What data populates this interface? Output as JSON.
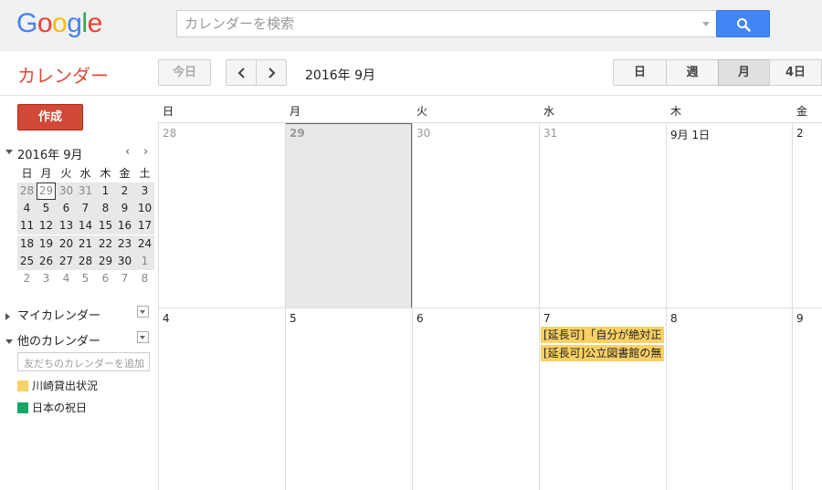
{
  "header": {
    "logo_letters": [
      {
        "ch": "G",
        "color": "#4285f4"
      },
      {
        "ch": "o",
        "color": "#ea4335"
      },
      {
        "ch": "o",
        "color": "#fbbc05"
      },
      {
        "ch": "g",
        "color": "#4285f4"
      },
      {
        "ch": "l",
        "color": "#34a853"
      },
      {
        "ch": "e",
        "color": "#ea4335"
      }
    ],
    "search_placeholder": "カレンダーを検索",
    "search_icon": "search-icon"
  },
  "toolbar": {
    "app_title": "カレンダー",
    "today_label": "今日",
    "prev_icon": "chevron-left-icon",
    "next_icon": "chevron-right-icon",
    "date_range": "2016年 9月",
    "views": {
      "day": "日",
      "week": "週",
      "month": "月",
      "four_day": "4日"
    },
    "active_view": "month"
  },
  "sidebar": {
    "create_label": "作成",
    "mini_calendar": {
      "title": "2016年 9月",
      "prev": "‹",
      "next": "›",
      "weekdays": [
        "日",
        "月",
        "火",
        "水",
        "木",
        "金",
        "土"
      ],
      "weeks": [
        [
          "28",
          "29",
          "30",
          "31",
          "1",
          "2",
          "3"
        ],
        [
          "4",
          "5",
          "6",
          "7",
          "8",
          "9",
          "10"
        ],
        [
          "11",
          "12",
          "13",
          "14",
          "15",
          "16",
          "17"
        ],
        [
          "18",
          "19",
          "20",
          "21",
          "22",
          "23",
          "24"
        ],
        [
          "25",
          "26",
          "27",
          "28",
          "29",
          "30",
          "1"
        ],
        [
          "2",
          "3",
          "4",
          "5",
          "6",
          "7",
          "8"
        ]
      ],
      "selected": "29"
    },
    "my_calendars_label": "マイカレンダー",
    "other_calendars_label": "他のカレンダー",
    "friend_placeholder": "友だちのカレンダーを追加",
    "calendars": [
      {
        "name": "川崎貸出状況",
        "color": "#fad165"
      },
      {
        "name": "日本の祝日",
        "color": "#16a765"
      }
    ]
  },
  "month_view": {
    "weekdays": [
      "日",
      "月",
      "火",
      "水",
      "木",
      "金"
    ],
    "weeks": [
      {
        "days": [
          "28",
          "29",
          "30",
          "31",
          "9月 1日",
          "2"
        ]
      },
      {
        "days": [
          "4",
          "5",
          "6",
          "7",
          "8",
          "9"
        ]
      }
    ],
    "events": [
      {
        "title": "[延長可]「自分が絶対正",
        "day": "7"
      },
      {
        "title": "[延長可]公立図書館の無",
        "day": "7"
      }
    ],
    "event_color": "#fad165"
  }
}
